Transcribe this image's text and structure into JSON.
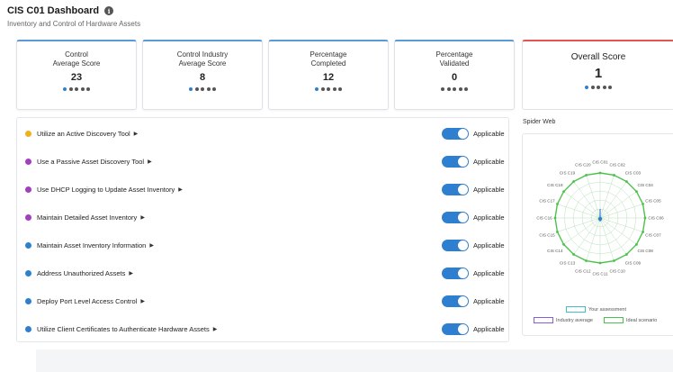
{
  "header": {
    "title": "CIS C01 Dashboard",
    "subtitle": "Inventory and Control of Hardware Assets"
  },
  "cards": [
    {
      "label_line1": "Control",
      "label_line2": "Average Score",
      "value": "23"
    },
    {
      "label_line1": "Control Industry",
      "label_line2": "Average Score",
      "value": "8"
    },
    {
      "label_line1": "Percentage",
      "label_line2": "Completed",
      "value": "12"
    },
    {
      "label_line1": "Percentage",
      "label_line2": "Validated",
      "value": "0"
    }
  ],
  "overall": {
    "label": "Overall Score",
    "value": "1"
  },
  "safeguards": [
    {
      "text": "Utilize an Active Discovery Tool",
      "color": "#f2b01e",
      "status": "Applicable"
    },
    {
      "text": "Use a Passive Asset Discovery Tool",
      "color": "#a23fc0",
      "status": "Applicable"
    },
    {
      "text": "Use DHCP Logging to Update Asset Inventory",
      "color": "#a23fc0",
      "status": "Applicable"
    },
    {
      "text": "Maintain Detailed Asset Inventory",
      "color": "#a23fc0",
      "status": "Applicable"
    },
    {
      "text": "Maintain Asset Inventory Information",
      "color": "#2f7fd1",
      "status": "Applicable"
    },
    {
      "text": "Address Unauthorized Assets",
      "color": "#2f7fd1",
      "status": "Applicable"
    },
    {
      "text": "Deploy Port Level Access Control",
      "color": "#2f7fd1",
      "status": "Applicable"
    },
    {
      "text": "Utilize Client Certificates to Authenticate Hardware Assets",
      "color": "#2f7fd1",
      "status": "Applicable"
    }
  ],
  "spider": {
    "title": "Spider Web",
    "axes": [
      "CIS C01",
      "CIS C02",
      "CIS C03",
      "CIS C04",
      "CIS C05",
      "CIS C06",
      "CIS C07",
      "CIS C08",
      "CIS C09",
      "CIS C10",
      "CIS C11",
      "CIS C12",
      "CIS C13",
      "CIS C14",
      "CIS C15",
      "CIS C16",
      "CIS C17",
      "CIS C18",
      "CIS C19",
      "CIS C20"
    ],
    "legend": {
      "your": "Your assessment",
      "industry": "Industry average",
      "ideal": "Ideal scenario"
    },
    "colors": {
      "your": "#3fc1c9",
      "industry": "#8a5cd6",
      "ideal": "#4cc24c",
      "grid": "#b9dfb9"
    }
  },
  "colors": {
    "accent": "#2f7fd1",
    "overall_accent": "#e35555"
  }
}
